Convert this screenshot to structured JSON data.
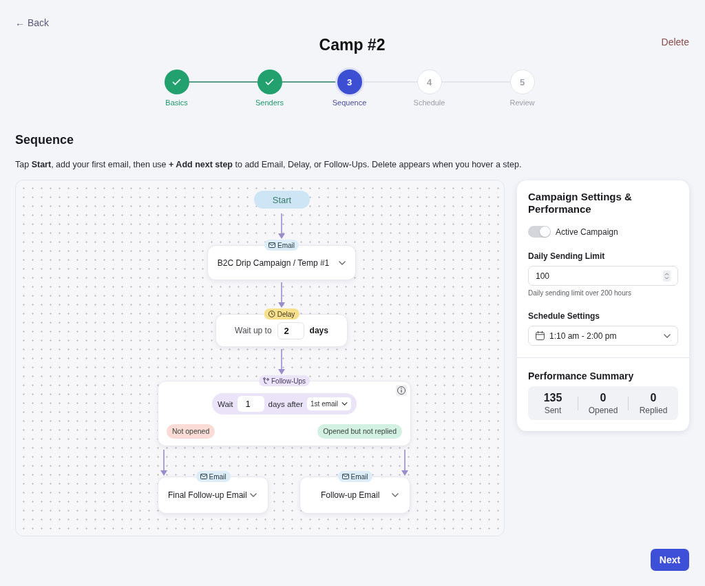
{
  "header": {
    "back": "← Back",
    "title": "Camp #2",
    "delete": "Delete"
  },
  "steps": [
    {
      "label": "Basics",
      "done": true,
      "selected": false
    },
    {
      "label": "Senders",
      "done": true,
      "selected": false
    },
    {
      "label": "Sequence",
      "number": "3",
      "done": false,
      "selected": true
    },
    {
      "label": "Schedule",
      "number": "4",
      "done": false,
      "selected": false
    },
    {
      "label": "Review",
      "number": "5",
      "done": false,
      "selected": false
    }
  ],
  "section": {
    "title": "Sequence",
    "instructions": "Tap **Start**, add your first email, then use **+ Add next step** to add Email, Delay, or Follow-Ups. Delete appears when you hover a step."
  },
  "flow": {
    "start": "Start",
    "email_step": {
      "tag": "Email",
      "template": "B2C Drip Campaign / Temp #1"
    },
    "delay_step": {
      "tag": "Delay",
      "prefix": "Wait up to",
      "value": "2",
      "unit": "days"
    },
    "followup_step": {
      "tag": "Follow-Ups",
      "wait": "Wait",
      "value": "1",
      "after": "days after",
      "reference": "1st email",
      "branches": [
        {
          "label": "Not opened",
          "color": "#fadbd6"
        },
        {
          "label": "Opened but not replied",
          "color": "#d2f1e2"
        }
      ]
    },
    "branch_emails": [
      {
        "tag": "Email",
        "template": "Final Follow-up Email"
      },
      {
        "tag": "Email",
        "template": "Follow-up Email"
      }
    ]
  },
  "settings": {
    "title": "Campaign Settings & Performance",
    "active": {
      "label": "Active Campaign",
      "on": true
    },
    "daily_limit": {
      "label": "Daily Sending Limit",
      "value": "100",
      "hint": "Daily sending limit over 200 hours"
    },
    "schedule": {
      "label": "Schedule Settings",
      "value": "1:10 am - 2:00 pm"
    },
    "summary": {
      "title": "Performance Summary",
      "stats": [
        {
          "value": "135",
          "label": "Sent"
        },
        {
          "value": "0",
          "label": "Opened"
        },
        {
          "value": "0",
          "label": "Replied"
        }
      ]
    }
  },
  "next": "Next"
}
